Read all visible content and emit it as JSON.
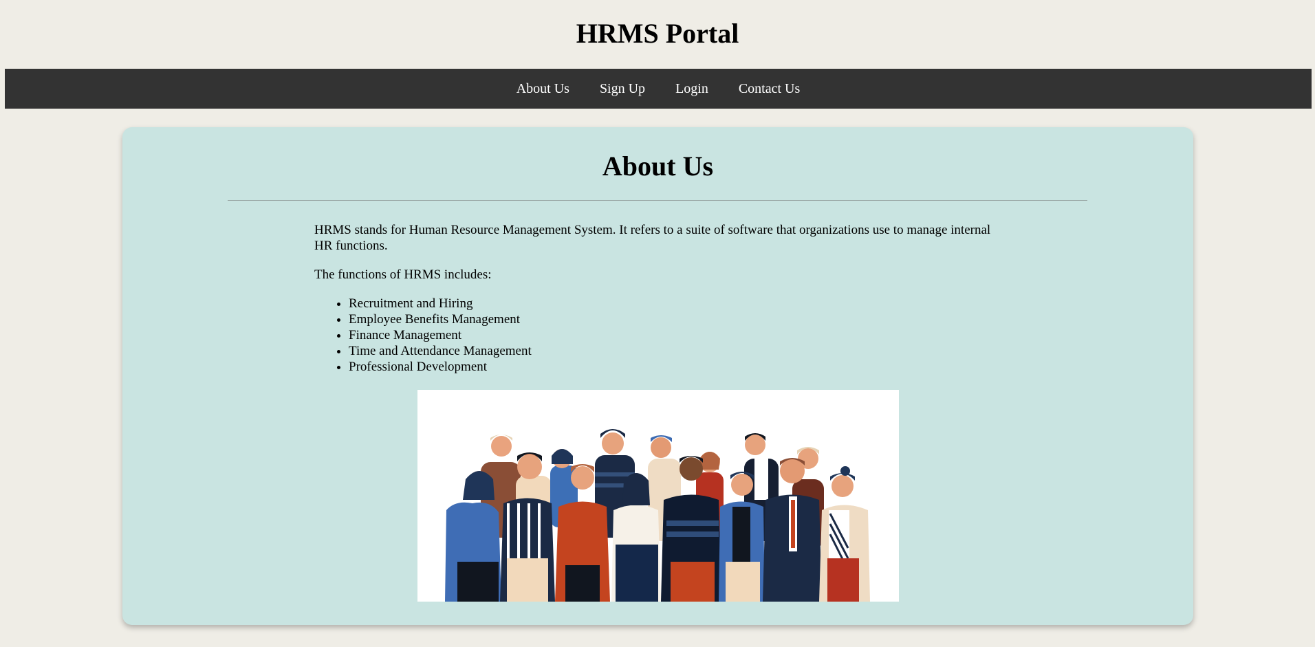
{
  "header": {
    "title": "HRMS Portal"
  },
  "nav": {
    "items": [
      {
        "label": "About Us"
      },
      {
        "label": "Sign Up"
      },
      {
        "label": "Login"
      },
      {
        "label": "Contact Us"
      }
    ]
  },
  "about": {
    "heading": "About Us",
    "intro": "HRMS stands for Human Resource Management System. It refers to a suite of software that organizations use to manage internal HR functions.",
    "functions_intro": "The functions of HRMS includes:",
    "functions": [
      "Recruitment and Hiring",
      "Employee Benefits Management",
      "Finance Management",
      "Time and Attendance Management",
      "Professional Development"
    ]
  },
  "colors": {
    "page_background": "#efede6",
    "navbar_background": "#333333",
    "card_background": "#c9e4e1"
  }
}
